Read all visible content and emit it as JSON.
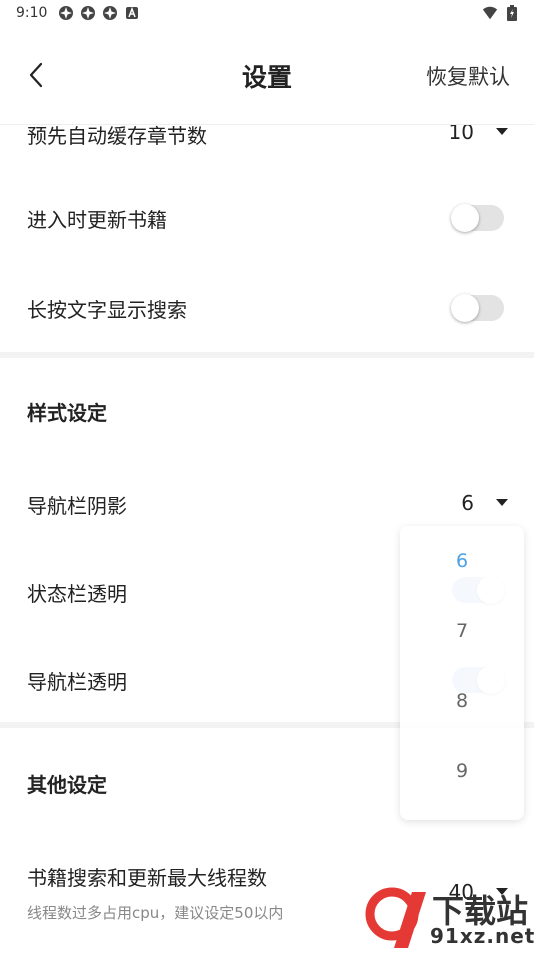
{
  "status_bar": {
    "time": "9:10"
  },
  "appbar": {
    "title": "设置",
    "restore_label": "恢复默认"
  },
  "rows": {
    "precache": {
      "label": "预先自动缓存章节数",
      "value": "10"
    },
    "update_on_enter": {
      "label": "进入时更新书籍",
      "on": false
    },
    "long_press": {
      "label": "长按文字显示搜索",
      "on": false
    },
    "nav_shadow": {
      "label": "导航栏阴影",
      "value": "6"
    },
    "status_transparent": {
      "label": "状态栏透明",
      "on": true
    },
    "nav_transparent": {
      "label": "导航栏透明",
      "on": true
    },
    "threads": {
      "label": "书籍搜索和更新最大线程数",
      "value": "40",
      "hint": "线程数过多占用cpu，建议设定50以内"
    }
  },
  "sections": {
    "style": "样式设定",
    "other": "其他设定"
  },
  "dropdown": {
    "options": [
      "6",
      "7",
      "8",
      "9"
    ],
    "selected": "6"
  },
  "watermark": {
    "main": "下载站",
    "sub": "91xz.net"
  },
  "colors": {
    "accent": "#4aa0e6",
    "toggle_on": "#a9cdf3",
    "toggle_off": "#e3e3e3"
  }
}
